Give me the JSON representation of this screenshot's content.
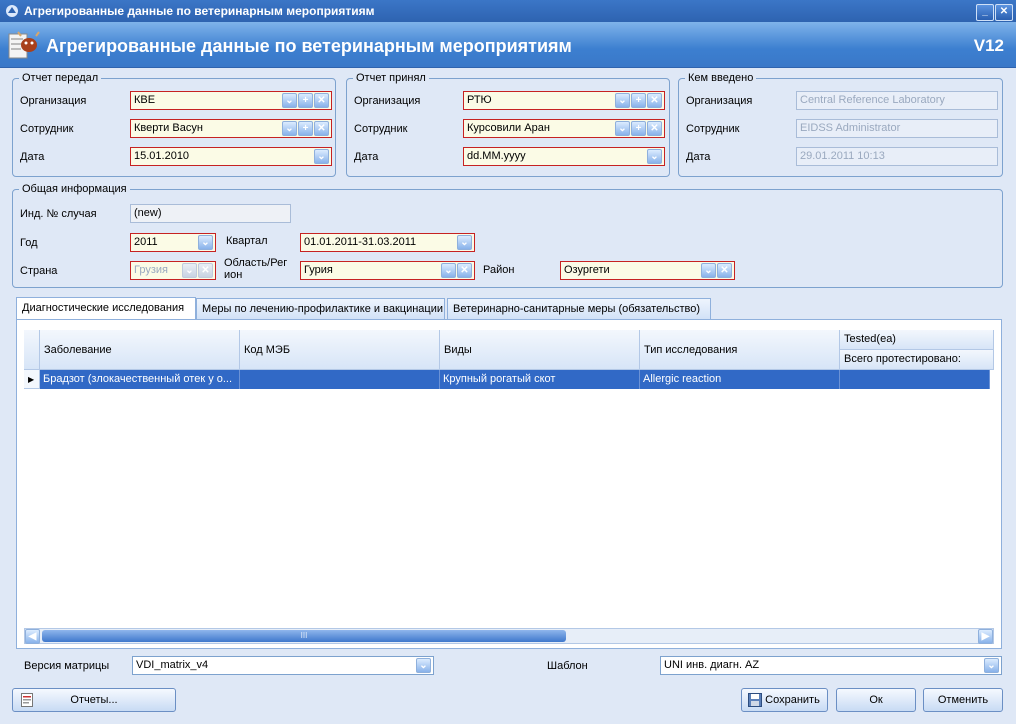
{
  "window": {
    "title": "Агрегированные данные по ветеринарным мероприятиям"
  },
  "header": {
    "title": "Агрегированные данные по ветеринарным мероприятиям",
    "version": "V12"
  },
  "sent": {
    "legend": "Отчет передал",
    "org_label": "Организация",
    "org_value": "КВЕ",
    "employee_label": "Сотрудник",
    "employee_value": "Кверти Васун",
    "date_label": "Дата",
    "date_value": "15.01.2010"
  },
  "received": {
    "legend": "Отчет принял",
    "org_label": "Организация",
    "org_value": "РТЮ",
    "employee_label": "Сотрудник",
    "employee_value": "Курсовили Аран",
    "date_label": "Дата",
    "date_value": "dd.MM.yyyy"
  },
  "entered": {
    "legend": "Кем введено",
    "org_label": "Организация",
    "org_value": "Central Reference Laboratory",
    "employee_label": "Сотрудник",
    "employee_value": "EIDSS Administrator",
    "date_label": "Дата",
    "date_value": "29.01.2011 10:13"
  },
  "general": {
    "legend": "Общая информация",
    "case_label": "Инд. № случая",
    "case_value": "(new)",
    "year_label": "Год",
    "year_value": "2011",
    "quarter_label": "Квартал",
    "quarter_value": "01.01.2011-31.03.2011",
    "country_label": "Страна",
    "country_value": "Грузия",
    "region_label_1": "Область/Рег",
    "region_label_2": "ион",
    "region_value": "Гурия",
    "rayon_label": "Район",
    "rayon_value": "Озургети"
  },
  "tabs": [
    {
      "label": "Диагностические исследования"
    },
    {
      "label": "Меры по лечению-профилактике и вакцинации"
    },
    {
      "label": "Ветеринарно-санитарные меры (обязательство)"
    }
  ],
  "grid": {
    "columns": [
      "Заболевание",
      "Код МЭБ",
      "Виды",
      "Тип исследования"
    ],
    "tested_header": "Tested(ea)",
    "tested_sub": "Всего протестировано:",
    "rows": [
      {
        "disease": "Брадзот (злокачественный отек у о...",
        "oie_code": "",
        "species": "Крупный рогатый скот",
        "test_type": "Allergic reaction",
        "tested": ""
      }
    ],
    "scroll_grip": "III"
  },
  "matrix": {
    "label": "Версия матрицы",
    "value": "VDI_matrix_v4"
  },
  "template": {
    "label": "Шаблон",
    "value": "UNI инв. диагн. AZ"
  },
  "buttons": {
    "reports": "Отчеты...",
    "save": "Сохранить",
    "ok": "Ок",
    "cancel": "Отменить"
  },
  "colors": {
    "accent": "#3169c6",
    "required_border": "#c62222",
    "header": "#3c7fd0"
  }
}
